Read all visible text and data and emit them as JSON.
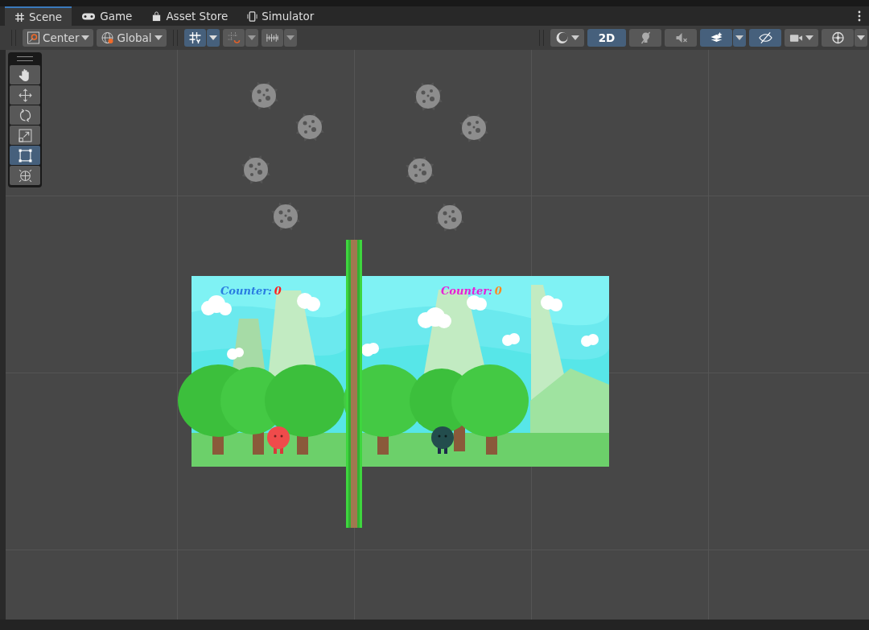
{
  "tabs": [
    {
      "label": "Scene",
      "kind": "grid",
      "selected": true
    },
    {
      "label": "Game",
      "kind": "gamepad",
      "selected": false
    },
    {
      "label": "Asset Store",
      "kind": "bag",
      "selected": false
    },
    {
      "label": "Simulator",
      "kind": "phone",
      "selected": false
    }
  ],
  "toolbar_left": [
    {
      "kind": "pivot",
      "label": "Center",
      "on": false,
      "dropdown": true
    },
    {
      "kind": "globe",
      "label": "Global",
      "on": false,
      "dropdown": true
    },
    {
      "kind": "grid-snap",
      "on": true,
      "dropdown": true
    },
    {
      "kind": "snap-magnet",
      "on": false,
      "dropdown": true
    },
    {
      "kind": "ruler",
      "on": false,
      "dropdown": true
    }
  ],
  "toolbar_right": [
    {
      "kind": "shading",
      "on": false,
      "dropdown": true
    },
    {
      "kind": "text",
      "label": "2D",
      "on": true,
      "dropdown": false
    },
    {
      "kind": "bulb",
      "on": false,
      "dropdown": false
    },
    {
      "kind": "speaker",
      "on": false,
      "dropdown": false
    },
    {
      "kind": "layers",
      "on": true,
      "dropdown": true
    },
    {
      "kind": "eye",
      "on": true,
      "dropdown": false
    },
    {
      "kind": "camera",
      "on": false,
      "dropdown": true
    },
    {
      "kind": "gizmo",
      "on": false,
      "dropdown": true
    }
  ],
  "tools": [
    {
      "kind": "hand",
      "selected": false
    },
    {
      "kind": "move",
      "selected": false
    },
    {
      "kind": "rotate",
      "selected": false
    },
    {
      "kind": "scale",
      "selected": false
    },
    {
      "kind": "rect",
      "selected": true
    },
    {
      "kind": "transform",
      "selected": false
    }
  ],
  "counters": [
    {
      "label": {
        "text": "Counter:",
        "color": "#2a7de1"
      },
      "value": {
        "text": "0",
        "color": "#ff1e1e"
      }
    },
    {
      "label": {
        "text": "Counter:",
        "color": "#e81ed8"
      },
      "value": {
        "text": "0",
        "color": "#ff8a1e"
      }
    }
  ]
}
